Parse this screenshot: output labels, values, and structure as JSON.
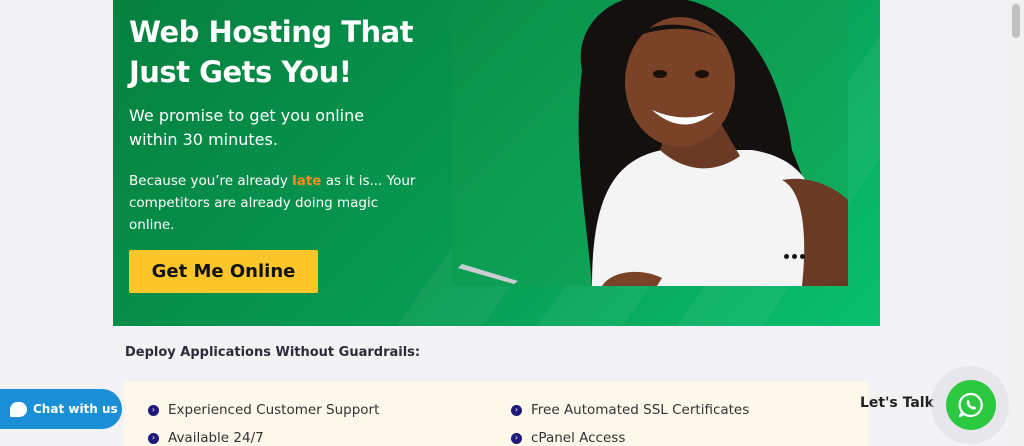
{
  "hero": {
    "headline": "Web Hosting That Just Gets You!",
    "promise": "We promise to get you online within 30 minutes.",
    "because_prefix": "Because you’re already ",
    "because_highlight": "late",
    "because_suffix": " as it is... Your competitors are already doing magic online.",
    "cta_label": "Get Me Online"
  },
  "deploy": {
    "title": "Deploy Applications Without Guardrails:",
    "features": [
      "Experienced Customer Support",
      "Free Automated SSL Certificates",
      "Available 24/7",
      "cPanel Access"
    ]
  },
  "chat_widget": {
    "label": "Chat with us"
  },
  "whatsapp": {
    "label": "Let's Talk"
  },
  "colors": {
    "hero_green": "#079a52",
    "cta_yellow": "#fbc629",
    "highlight_orange": "#ff8c1a",
    "chat_blue": "#1a8fd6",
    "whatsapp_green": "#2bc840",
    "bullet_navy": "#1f1a7a"
  }
}
